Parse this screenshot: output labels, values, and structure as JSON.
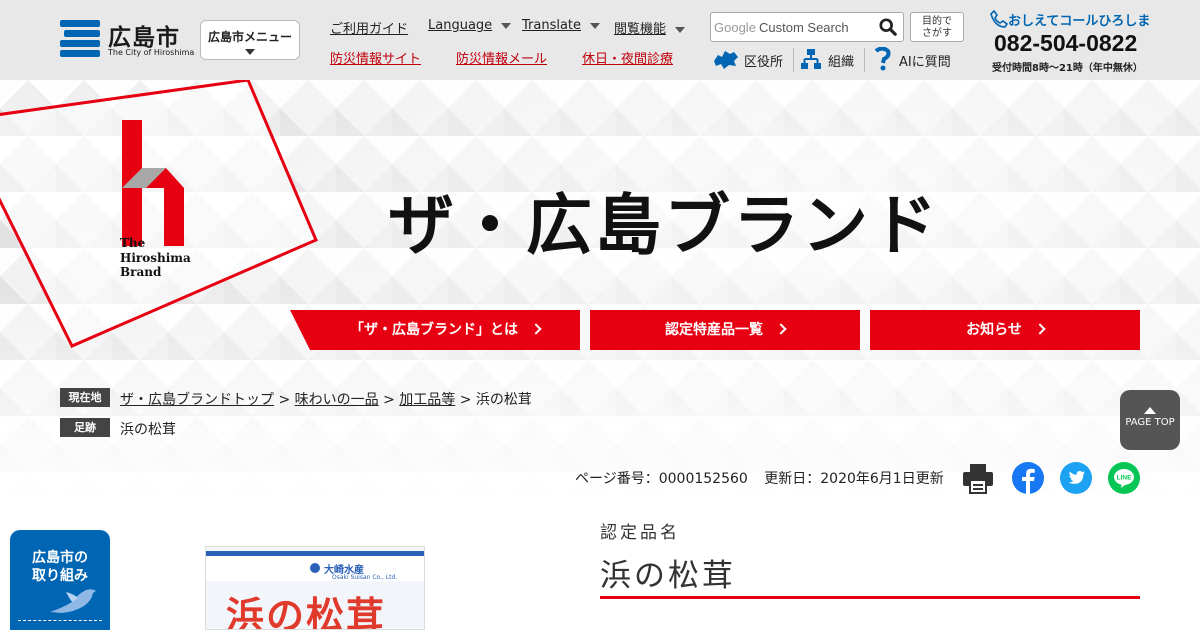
{
  "header": {
    "logo": {
      "title": "広島市",
      "subtitle": "The City of Hiroshima"
    },
    "menu_button": "広島市メニュー",
    "nav_top": [
      {
        "label": "ご利用ガイド",
        "dropdown": false
      },
      {
        "label": "Language",
        "dropdown": true
      },
      {
        "label": "Translate",
        "dropdown": true
      },
      {
        "label": "閲覧機能",
        "dropdown": true
      }
    ],
    "nav_bottom": [
      "防災情報サイト",
      "防災情報メール",
      "休日・夜間診療"
    ],
    "search": {
      "placeholder": "Custom Search",
      "brand": "Google"
    },
    "mokuteki": [
      "目的で",
      "さがす"
    ],
    "subnav": [
      "区役所",
      "組織",
      "AIに質問"
    ],
    "call": {
      "title": "おしえてコールひろしま",
      "number": "082-504-0822",
      "hours": "受付時間8時～21時（年中無休）"
    }
  },
  "hero": {
    "brand_text": [
      "The",
      "Hiroshima",
      "Brand"
    ],
    "title": "ザ・広島ブランド",
    "buttons": [
      "「ザ・広島ブランド」とは",
      "認定特産品一覧",
      "お知らせ"
    ]
  },
  "breadcrumb": {
    "current_label": "現在地",
    "links": [
      "ザ・広島ブランドトップ",
      "味わいの一品",
      "加工品等"
    ],
    "current": "浜の松茸",
    "separator": ">",
    "footprint_label": "足跡",
    "footprint": "浜の松茸"
  },
  "page_top": "PAGE TOP",
  "meta": {
    "page_number": "ページ番号：0000152560",
    "updated": "更新日：2020年6月1日更新"
  },
  "share": [
    "print-icon",
    "facebook-icon",
    "twitter-icon",
    "line-icon"
  ],
  "side_banner": [
    "広島市の",
    "取り組み"
  ],
  "product": {
    "image_text": "浜の松茸",
    "maker": "大崎水産",
    "maker_en": "Osaki Suisan Co., Ltd.",
    "cert_label": "認定品名",
    "cert_name": "浜の松茸"
  },
  "colors": {
    "brand_red": "#e60012",
    "city_blue": "#0066b3",
    "header_bg": "#e8e8e8",
    "nav_red": "#c0000c"
  }
}
